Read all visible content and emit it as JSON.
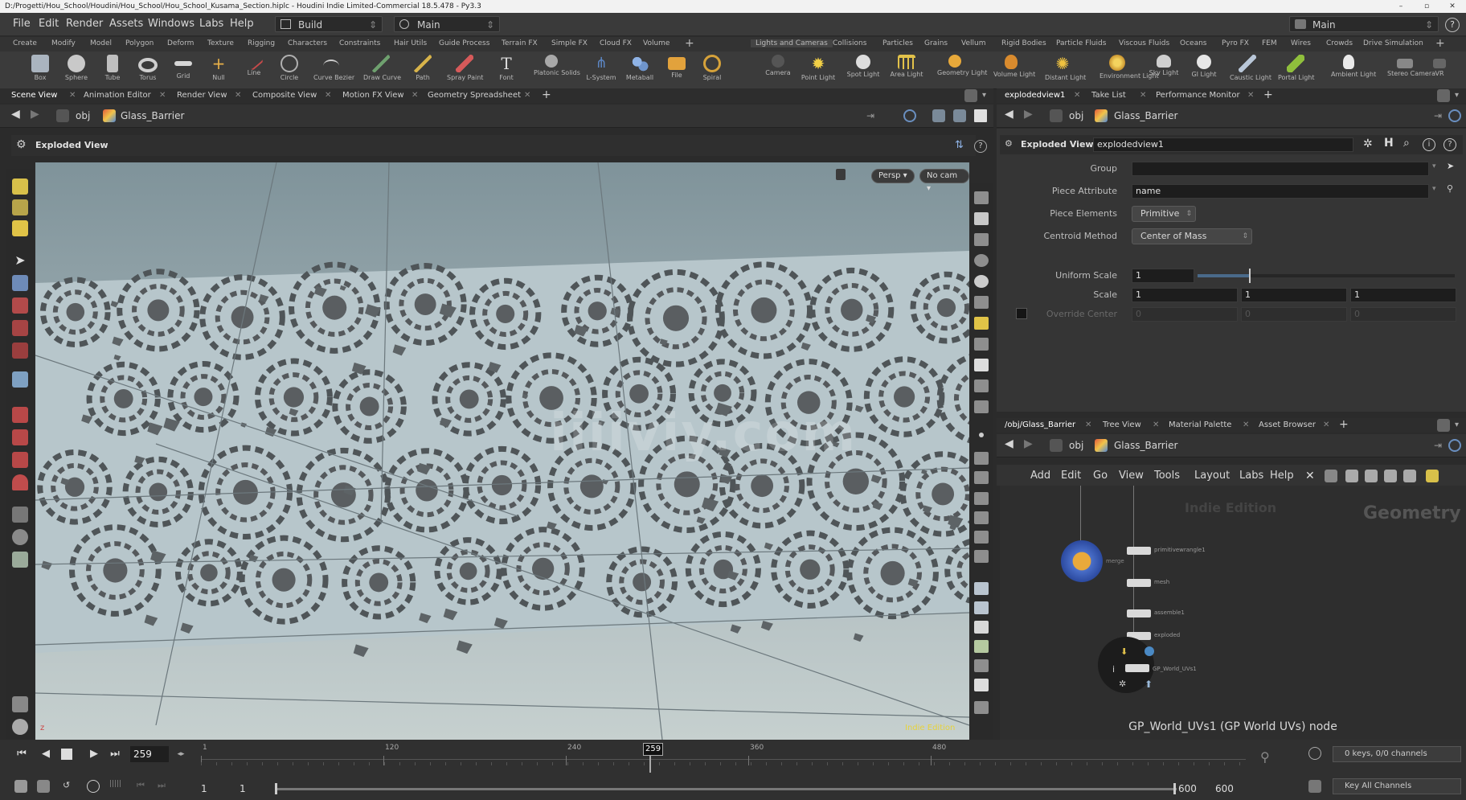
{
  "window": {
    "title": "D:/Progetti/Hou_School/Houdini/Hou_School/Hou_School_Kusama_Section.hiplc - Houdini Indie Limited-Commercial 18.5.478 - Py3.3",
    "controls": [
      "–",
      "▫",
      "✕"
    ]
  },
  "menubar": {
    "items": [
      "File",
      "Edit",
      "Render",
      "Assets",
      "Windows",
      "Labs",
      "Help"
    ],
    "desktop": "Build",
    "desktop2": "Main",
    "right_desktop": "Main"
  },
  "shelf": {
    "left_tabs": [
      "Create",
      "Modify",
      "Model",
      "Polygon",
      "Deform",
      "Texture",
      "Rigging",
      "Characters",
      "Constraints",
      "Hair Utils",
      "Guide Process",
      "Terrain FX",
      "Simple FX",
      "Cloud FX",
      "Volume"
    ],
    "right_tabs": [
      "Lights and Cameras",
      "Collisions",
      "Particles",
      "Grains",
      "Vellum",
      "Rigid Bodies",
      "Particle Fluids",
      "Viscous Fluids",
      "Oceans",
      "Pyro FX",
      "FEM",
      "Wires",
      "Crowds",
      "Drive Simulation"
    ],
    "left_tools": [
      "Box",
      "Sphere",
      "Tube",
      "Torus",
      "Grid",
      "Null",
      "Line",
      "Circle",
      "Curve Bezier",
      "Draw Curve",
      "Path",
      "Spray Paint",
      "Font",
      "Platonic Solids",
      "L-System",
      "Metaball",
      "File",
      "Spiral"
    ],
    "right_tools": [
      "Camera",
      "Point Light",
      "Spot Light",
      "Area Light",
      "Geometry Light",
      "Volume Light",
      "Distant Light",
      "Environment Light",
      "Sky Light",
      "GI Light",
      "Caustic Light",
      "Portal Light",
      "Ambient Light",
      "Stereo Camera",
      "VR"
    ]
  },
  "left_pane": {
    "tabs": [
      "Scene View",
      "Animation Editor",
      "Render View",
      "Composite View",
      "Motion FX View",
      "Geometry Spreadsheet"
    ],
    "path_root": "obj",
    "path_node": "Glass_Barrier",
    "tool_title": "Exploded View",
    "viewport": {
      "persp_label": "Persp ▾",
      "cam_label": "No cam ▾",
      "watermark": "iiiiviy.com",
      "corner_note": "Indie Edition"
    }
  },
  "param_pane": {
    "tabs": [
      "explodedview1",
      "Take List",
      "Performance Monitor"
    ],
    "path_root": "obj",
    "path_node": "Glass_Barrier",
    "node_type": "Exploded View",
    "node_name": "explodedview1",
    "params": {
      "group_label": "Group",
      "group_value": "",
      "piece_attr_label": "Piece Attribute",
      "piece_attr_value": "name",
      "piece_elements_label": "Piece Elements",
      "piece_elements_value": "Primitive",
      "centroid_label": "Centroid Method",
      "centroid_value": "Center of Mass",
      "uniform_scale_label": "Uniform Scale",
      "uniform_scale_value": "1",
      "uniform_scale_slider_fraction": 0.2,
      "scale_label": "Scale",
      "scale_x": "1",
      "scale_y": "1",
      "scale_z": "1",
      "override_center_label": "Override Center",
      "override_x": "0",
      "override_y": "0",
      "override_z": "0"
    }
  },
  "network_pane": {
    "tabs": [
      "/obj/Glass_Barrier",
      "Tree View",
      "Material Palette",
      "Asset Browser"
    ],
    "path_root": "obj",
    "path_node": "Glass_Barrier",
    "menu": [
      "Add",
      "Edit",
      "Go",
      "View",
      "Tools",
      "Layout",
      "Labs",
      "Help"
    ],
    "edition_label": "Indie Edition",
    "context_label": "Geometry",
    "node_info": "GP_World_UVs1 (GP World UVs) node",
    "nodes": [
      {
        "label": "primitivewrangle1"
      },
      {
        "label": "mesh"
      },
      {
        "label": "assemble1"
      },
      {
        "label": "exploded"
      },
      {
        "label": "GP_World_UVs1"
      }
    ]
  },
  "timeline": {
    "current_frame": "259",
    "frame_marker": "259",
    "ticks": [
      "1",
      "120",
      "240",
      "360",
      "480"
    ],
    "range_start": "1",
    "range_start2": "1",
    "range_end": "600",
    "range_end2": "600",
    "keys_label": "0 keys, 0/0 channels",
    "key_all_label": "Key All Channels"
  }
}
